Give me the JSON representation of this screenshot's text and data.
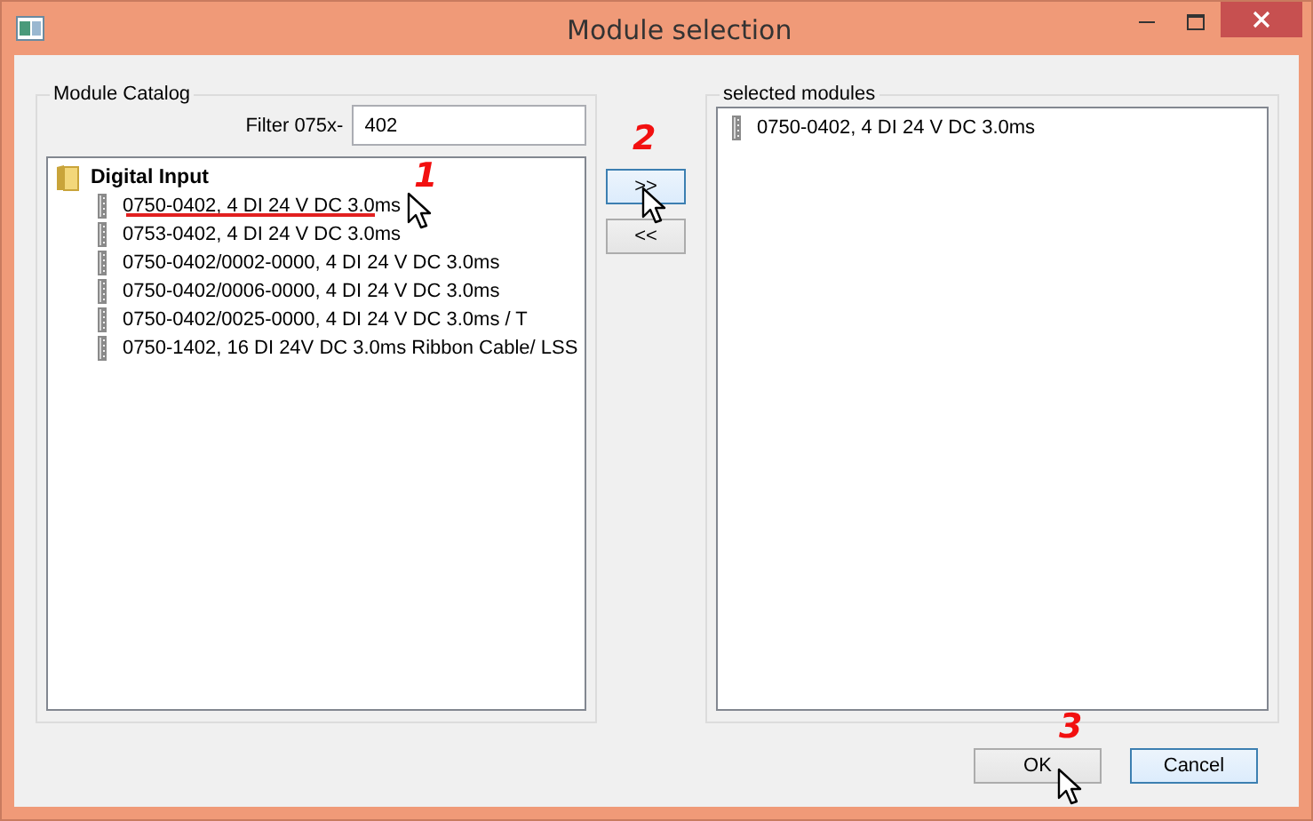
{
  "window": {
    "title": "Module selection"
  },
  "catalog": {
    "title": "Module Catalog",
    "filter_label": "Filter  075x-",
    "filter_value": "402",
    "tree": [
      {
        "label": "Digital Input",
        "children": [
          {
            "label": "0750-0402, 4 DI 24 V DC 3.0ms"
          },
          {
            "label": "0753-0402, 4 DI 24 V DC 3.0ms"
          },
          {
            "label": "0750-0402/0002-0000, 4 DI 24 V DC 3.0ms"
          },
          {
            "label": "0750-0402/0006-0000, 4 DI 24 V DC 3.0ms"
          },
          {
            "label": "0750-0402/0025-0000, 4 DI 24 V DC 3.0ms / T"
          },
          {
            "label": "0750-1402, 16 DI 24V DC 3.0ms Ribbon Cable/ LSS"
          }
        ]
      }
    ]
  },
  "transfer_buttons": [
    {
      "label": ">>",
      "highlighted": true
    },
    {
      "label": "<<",
      "highlighted": false
    }
  ],
  "selected": {
    "title": "selected modules",
    "items": [
      {
        "label": "0750-0402, 4 DI 24 V DC 3.0ms"
      }
    ]
  },
  "buttons": [
    {
      "label": "OK",
      "highlighted": false
    },
    {
      "label": "Cancel",
      "highlighted": true
    }
  ],
  "annotations": [
    {
      "text": "1"
    },
    {
      "text": "2"
    },
    {
      "text": "3"
    }
  ]
}
